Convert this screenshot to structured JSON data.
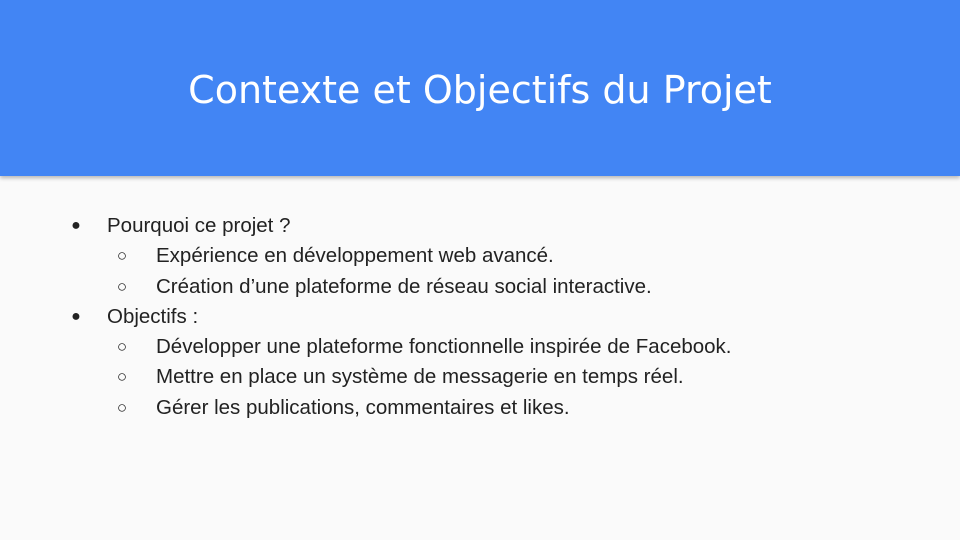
{
  "slide": {
    "title": "Contexte et Objectifs du Projet",
    "colors": {
      "header_background": "#4285f4",
      "title_text": "#ffffff",
      "body_text": "#222222",
      "slide_background": "#fafafa"
    },
    "bullets": {
      "level1_glyph": "●",
      "level2_glyph": "○"
    },
    "sections": [
      {
        "label": "Pourquoi ce projet ?",
        "items": [
          "Expérience en développement web avancé.",
          "Création d’une plateforme de réseau social interactive."
        ]
      },
      {
        "label": "Objectifs :",
        "items": [
          "Développer une plateforme fonctionnelle inspirée de Facebook.",
          "Mettre en place un système de messagerie en temps réel.",
          "Gérer les publications, commentaires et likes."
        ]
      }
    ]
  }
}
